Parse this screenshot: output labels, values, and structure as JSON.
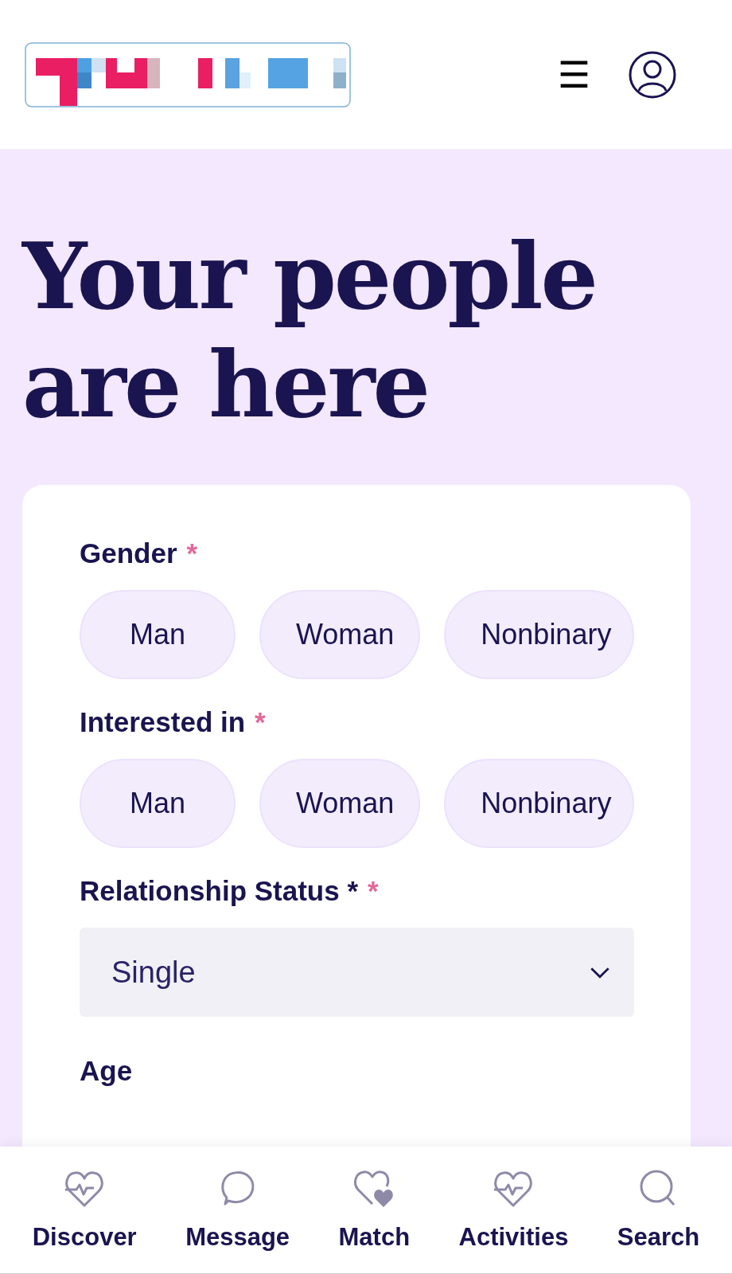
{
  "header": {
    "menu": "☰"
  },
  "hero": {
    "title_lines": [
      "Your people",
      "are here"
    ]
  },
  "form": {
    "groups": [
      {
        "label": "Gender",
        "required_mark": "*",
        "options": [
          {
            "label": "Man",
            "selected": false
          },
          {
            "label": "Woman",
            "selected": false
          },
          {
            "label": "Nonbinary",
            "selected": false
          }
        ]
      },
      {
        "label": "Interested in",
        "required_mark": "*",
        "options": [
          {
            "label": "Man",
            "selected": false
          },
          {
            "label": "Woman",
            "selected": false
          },
          {
            "label": "Nonbinary",
            "selected": false
          }
        ]
      }
    ],
    "status": {
      "label": "Relationship Status *",
      "required_mark": "*",
      "value": "Single"
    },
    "age": {
      "label": "Age"
    }
  },
  "nav": [
    {
      "label": "Discover",
      "selected": false
    },
    {
      "label": "Message",
      "selected": false
    },
    {
      "label": "Match",
      "selected": false
    },
    {
      "label": "Activities",
      "selected": false
    },
    {
      "label": "Search",
      "selected": false
    }
  ]
}
